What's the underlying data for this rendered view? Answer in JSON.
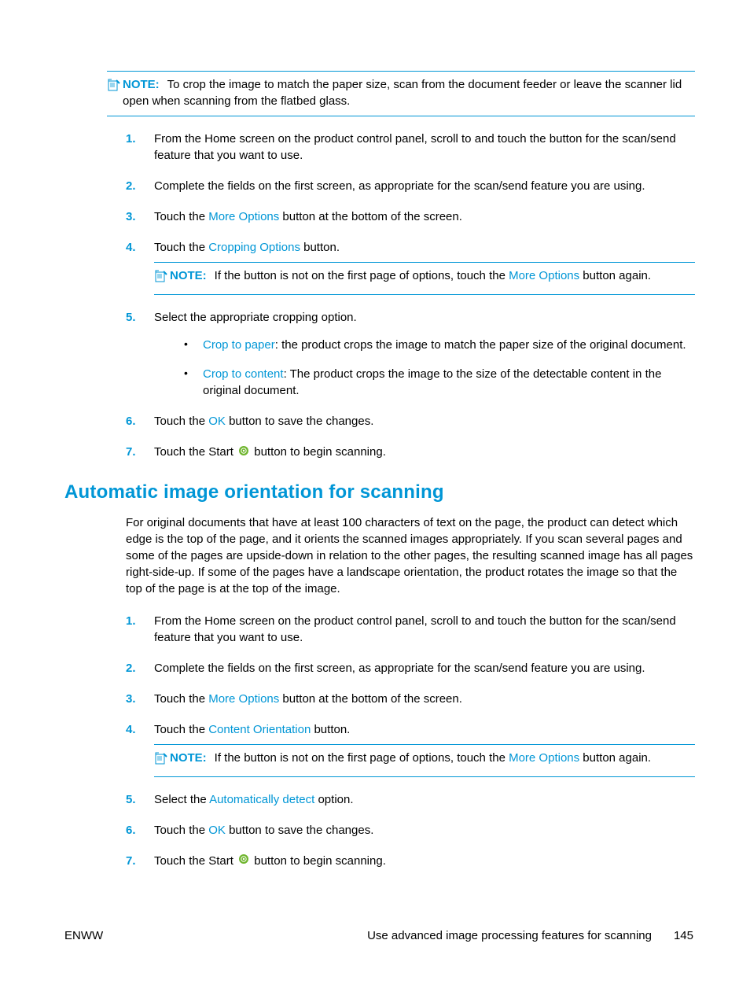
{
  "note_label": "NOTE:",
  "section1": {
    "note_text": "To crop the image to match the paper size, scan from the document feeder or leave the scanner lid open when scanning from the flatbed glass.",
    "steps": {
      "s1": "From the Home screen on the product control panel, scroll to and touch the button for the scan/send feature that you want to use.",
      "s2": "Complete the fields on the first screen, as appropriate for the scan/send feature you are using.",
      "s3_pre": "Touch the ",
      "s3_ref": "More Options",
      "s3_post": " button at the bottom of the screen.",
      "s4_pre": "Touch the ",
      "s4_ref": "Cropping Options",
      "s4_post": " button.",
      "s4_note_pre": "If the button is not on the first page of options, touch the ",
      "s4_note_ref": "More Options",
      "s4_note_post": " button again.",
      "s5": "Select the appropriate cropping option.",
      "s5_b1_ref": "Crop to paper",
      "s5_b1_post": ": the product crops the image to match the paper size of the original document.",
      "s5_b2_ref": "Crop to content",
      "s5_b2_post": ": The product crops the image to the size of the detectable content in the original document.",
      "s6_pre": "Touch the ",
      "s6_ref": "OK",
      "s6_post": " button to save the changes.",
      "s7_pre": "Touch the Start ",
      "s7_post": " button to begin scanning."
    }
  },
  "section2": {
    "heading": "Automatic image orientation for scanning",
    "intro": "For original documents that have at least 100 characters of text on the page, the product can detect which edge is the top of the page, and it orients the scanned images appropriately. If you scan several pages and some of the pages are upside-down in relation to the other pages, the resulting scanned image has all pages right-side-up. If some of the pages have a landscape orientation, the product rotates the image so that the top of the page is at the top of the image.",
    "steps": {
      "s1": "From the Home screen on the product control panel, scroll to and touch the button for the scan/send feature that you want to use.",
      "s2": "Complete the fields on the first screen, as appropriate for the scan/send feature you are using.",
      "s3_pre": "Touch the ",
      "s3_ref": "More Options",
      "s3_post": " button at the bottom of the screen.",
      "s4_pre": "Touch the ",
      "s4_ref": "Content Orientation",
      "s4_post": " button.",
      "s4_note_pre": "If the button is not on the first page of options, touch the ",
      "s4_note_ref": "More Options",
      "s4_note_post": " button again.",
      "s5_pre": "Select the ",
      "s5_ref": "Automatically detect",
      "s5_post": " option.",
      "s6_pre": "Touch the ",
      "s6_ref": "OK",
      "s6_post": " button to save the changes.",
      "s7_pre": "Touch the Start ",
      "s7_post": " button to begin scanning."
    }
  },
  "footer": {
    "left": "ENWW",
    "right_text": "Use advanced image processing features for scanning",
    "page_num": "145"
  }
}
